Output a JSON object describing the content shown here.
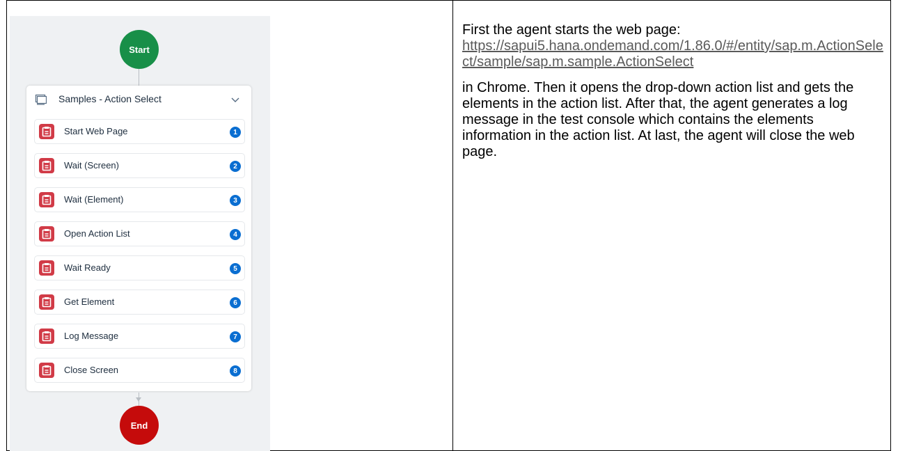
{
  "flow": {
    "start_label": "Start",
    "end_label": "End",
    "group": {
      "title": "Samples - Action Select",
      "steps": [
        {
          "label": "Start Web Page",
          "number": "1"
        },
        {
          "label": "Wait (Screen)",
          "number": "2"
        },
        {
          "label": "Wait (Element)",
          "number": "3"
        },
        {
          "label": "Open Action List",
          "number": "4"
        },
        {
          "label": "Wait Ready",
          "number": "5"
        },
        {
          "label": "Get Element",
          "number": "6"
        },
        {
          "label": "Log Message",
          "number": "7"
        },
        {
          "label": "Close Screen",
          "number": "8"
        }
      ]
    }
  },
  "description": {
    "intro": "First the agent starts the web page:",
    "link": "https://sapui5.hana.ondemand.com/1.86.0/#/entity/sap.m.ActionSelect/sample/sap.m.sample.ActionSelect",
    "body": "in Chrome. Then it opens the drop-down action list and gets the elements in the action list. After that, the agent generates a log message in the test console which contains the elements information in the action list. At last, the agent will close the web page."
  },
  "colors": {
    "start": "#188f48",
    "end": "#c50b0b",
    "step_icon": "#d13b47",
    "badge": "#0a6ed1",
    "canvas": "#eff1f3"
  }
}
